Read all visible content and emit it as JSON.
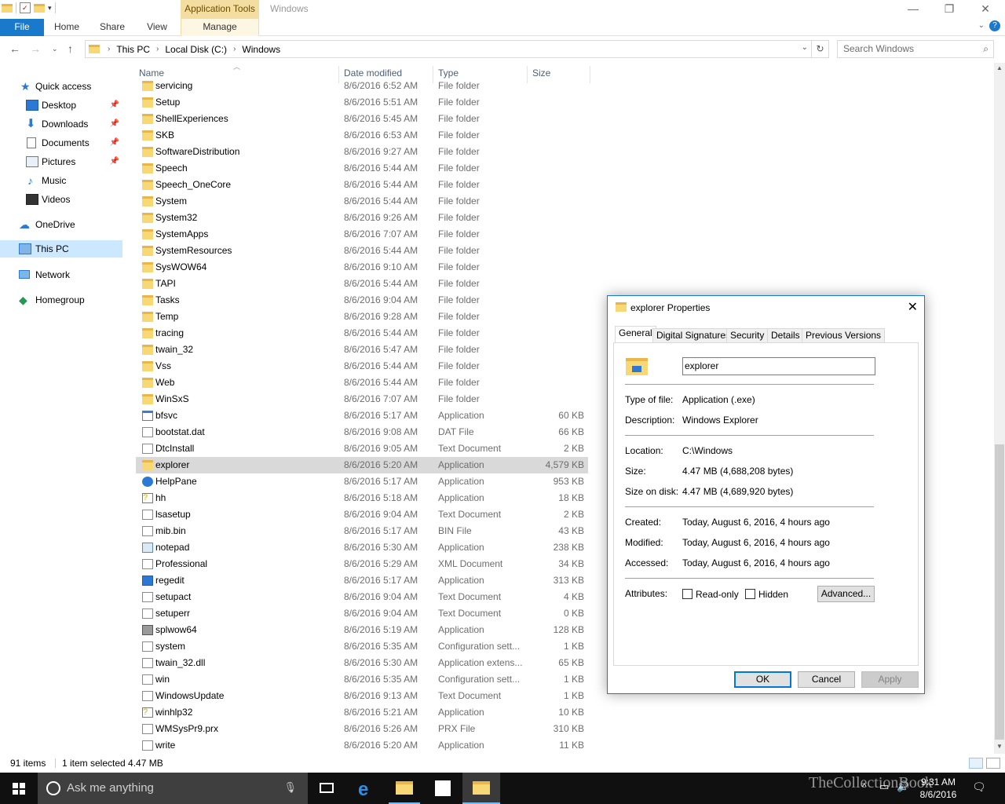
{
  "window": {
    "title": "Windows",
    "context_tab_title": "Application Tools",
    "controls": {
      "minimize": "—",
      "maximize": "❐",
      "close": "✕"
    }
  },
  "ribbon": {
    "tabs": [
      {
        "label": "File"
      },
      {
        "label": "Home"
      },
      {
        "label": "Share"
      },
      {
        "label": "View"
      },
      {
        "label": "Manage"
      }
    ]
  },
  "address": {
    "crumbs": [
      "This PC",
      "Local Disk (C:)",
      "Windows"
    ],
    "search_placeholder": "Search Windows"
  },
  "nav": {
    "items": [
      {
        "label": "Quick access",
        "icon": "star-icon",
        "pinned": false
      },
      {
        "label": "Desktop",
        "icon": "desktop-icon",
        "pinned": true
      },
      {
        "label": "Downloads",
        "icon": "download-icon",
        "pinned": true
      },
      {
        "label": "Documents",
        "icon": "documents-icon",
        "pinned": true
      },
      {
        "label": "Pictures",
        "icon": "pictures-icon",
        "pinned": true
      },
      {
        "label": "Music",
        "icon": "music-icon",
        "pinned": false
      },
      {
        "label": "Videos",
        "icon": "videos-icon",
        "pinned": false
      },
      {
        "label": "OneDrive",
        "icon": "cloud-icon",
        "pinned": false
      },
      {
        "label": "This PC",
        "icon": "computer-icon",
        "pinned": false,
        "selected": true
      },
      {
        "label": "Network",
        "icon": "network-icon",
        "pinned": false
      },
      {
        "label": "Homegroup",
        "icon": "homegroup-icon",
        "pinned": false
      }
    ]
  },
  "columns": {
    "name": "Name",
    "date": "Date modified",
    "type": "Type",
    "size": "Size"
  },
  "files": [
    {
      "name": "servicing",
      "date": "8/6/2016 6:52 AM",
      "type": "File folder",
      "size": "",
      "kind": "folder"
    },
    {
      "name": "Setup",
      "date": "8/6/2016 5:51 AM",
      "type": "File folder",
      "size": "",
      "kind": "folder"
    },
    {
      "name": "ShellExperiences",
      "date": "8/6/2016 5:45 AM",
      "type": "File folder",
      "size": "",
      "kind": "folder"
    },
    {
      "name": "SKB",
      "date": "8/6/2016 6:53 AM",
      "type": "File folder",
      "size": "",
      "kind": "folder"
    },
    {
      "name": "SoftwareDistribution",
      "date": "8/6/2016 9:27 AM",
      "type": "File folder",
      "size": "",
      "kind": "folder"
    },
    {
      "name": "Speech",
      "date": "8/6/2016 5:44 AM",
      "type": "File folder",
      "size": "",
      "kind": "folder"
    },
    {
      "name": "Speech_OneCore",
      "date": "8/6/2016 5:44 AM",
      "type": "File folder",
      "size": "",
      "kind": "folder"
    },
    {
      "name": "System",
      "date": "8/6/2016 5:44 AM",
      "type": "File folder",
      "size": "",
      "kind": "folder"
    },
    {
      "name": "System32",
      "date": "8/6/2016 9:26 AM",
      "type": "File folder",
      "size": "",
      "kind": "folder"
    },
    {
      "name": "SystemApps",
      "date": "8/6/2016 7:07 AM",
      "type": "File folder",
      "size": "",
      "kind": "folder"
    },
    {
      "name": "SystemResources",
      "date": "8/6/2016 5:44 AM",
      "type": "File folder",
      "size": "",
      "kind": "folder"
    },
    {
      "name": "SysWOW64",
      "date": "8/6/2016 9:10 AM",
      "type": "File folder",
      "size": "",
      "kind": "folder"
    },
    {
      "name": "TAPI",
      "date": "8/6/2016 5:44 AM",
      "type": "File folder",
      "size": "",
      "kind": "folder"
    },
    {
      "name": "Tasks",
      "date": "8/6/2016 9:04 AM",
      "type": "File folder",
      "size": "",
      "kind": "folder"
    },
    {
      "name": "Temp",
      "date": "8/6/2016 9:28 AM",
      "type": "File folder",
      "size": "",
      "kind": "folder"
    },
    {
      "name": "tracing",
      "date": "8/6/2016 5:44 AM",
      "type": "File folder",
      "size": "",
      "kind": "folder"
    },
    {
      "name": "twain_32",
      "date": "8/6/2016 5:47 AM",
      "type": "File folder",
      "size": "",
      "kind": "folder"
    },
    {
      "name": "Vss",
      "date": "8/6/2016 5:44 AM",
      "type": "File folder",
      "size": "",
      "kind": "folder"
    },
    {
      "name": "Web",
      "date": "8/6/2016 5:44 AM",
      "type": "File folder",
      "size": "",
      "kind": "folder"
    },
    {
      "name": "WinSxS",
      "date": "8/6/2016 7:07 AM",
      "type": "File folder",
      "size": "",
      "kind": "folder"
    },
    {
      "name": "bfsvc",
      "date": "8/6/2016 5:17 AM",
      "type": "Application",
      "size": "60 KB",
      "kind": "app"
    },
    {
      "name": "bootstat.dat",
      "date": "8/6/2016 9:08 AM",
      "type": "DAT File",
      "size": "66 KB",
      "kind": "doc"
    },
    {
      "name": "DtcInstall",
      "date": "8/6/2016 9:05 AM",
      "type": "Text Document",
      "size": "2 KB",
      "kind": "doc"
    },
    {
      "name": "explorer",
      "date": "8/6/2016 5:20 AM",
      "type": "Application",
      "size": "4,579 KB",
      "kind": "explorer",
      "selected": true
    },
    {
      "name": "HelpPane",
      "date": "8/6/2016 5:17 AM",
      "type": "Application",
      "size": "953 KB",
      "kind": "help"
    },
    {
      "name": "hh",
      "date": "8/6/2016 5:18 AM",
      "type": "Application",
      "size": "18 KB",
      "kind": "hh"
    },
    {
      "name": "lsasetup",
      "date": "8/6/2016 9:04 AM",
      "type": "Text Document",
      "size": "2 KB",
      "kind": "doc"
    },
    {
      "name": "mib.bin",
      "date": "8/6/2016 5:17 AM",
      "type": "BIN File",
      "size": "43 KB",
      "kind": "doc"
    },
    {
      "name": "notepad",
      "date": "8/6/2016 5:30 AM",
      "type": "Application",
      "size": "238 KB",
      "kind": "notepad"
    },
    {
      "name": "Professional",
      "date": "8/6/2016 5:29 AM",
      "type": "XML Document",
      "size": "34 KB",
      "kind": "xml"
    },
    {
      "name": "regedit",
      "date": "8/6/2016 5:17 AM",
      "type": "Application",
      "size": "313 KB",
      "kind": "regedit"
    },
    {
      "name": "setupact",
      "date": "8/6/2016 9:04 AM",
      "type": "Text Document",
      "size": "4 KB",
      "kind": "doc"
    },
    {
      "name": "setuperr",
      "date": "8/6/2016 9:04 AM",
      "type": "Text Document",
      "size": "0 KB",
      "kind": "doc"
    },
    {
      "name": "splwow64",
      "date": "8/6/2016 5:19 AM",
      "type": "Application",
      "size": "128 KB",
      "kind": "printer"
    },
    {
      "name": "system",
      "date": "8/6/2016 5:35 AM",
      "type": "Configuration sett...",
      "size": "1 KB",
      "kind": "config"
    },
    {
      "name": "twain_32.dll",
      "date": "8/6/2016 5:30 AM",
      "type": "Application extens...",
      "size": "65 KB",
      "kind": "dll"
    },
    {
      "name": "win",
      "date": "8/6/2016 5:35 AM",
      "type": "Configuration sett...",
      "size": "1 KB",
      "kind": "config"
    },
    {
      "name": "WindowsUpdate",
      "date": "8/6/2016 9:13 AM",
      "type": "Text Document",
      "size": "1 KB",
      "kind": "doc"
    },
    {
      "name": "winhlp32",
      "date": "8/6/2016 5:21 AM",
      "type": "Application",
      "size": "10 KB",
      "kind": "hh"
    },
    {
      "name": "WMSysPr9.prx",
      "date": "8/6/2016 5:26 AM",
      "type": "PRX File",
      "size": "310 KB",
      "kind": "doc"
    },
    {
      "name": "write",
      "date": "8/6/2016 5:20 AM",
      "type": "Application",
      "size": "11 KB",
      "kind": "write"
    }
  ],
  "status": {
    "count": "91 items",
    "selection": "1 item selected  4.47 MB"
  },
  "dialog": {
    "title": "explorer Properties",
    "tabs": [
      "General",
      "Digital Signatures",
      "Security",
      "Details",
      "Previous Versions"
    ],
    "name_value": "explorer",
    "fields": {
      "type_label": "Type of file:",
      "type_value": "Application (.exe)",
      "desc_label": "Description:",
      "desc_value": "Windows Explorer",
      "loc_label": "Location:",
      "loc_value": "C:\\Windows",
      "size_label": "Size:",
      "size_value": "4.47 MB (4,688,208 bytes)",
      "sod_label": "Size on disk:",
      "sod_value": "4.47 MB (4,689,920 bytes)",
      "created_label": "Created:",
      "created_value": "Today, August 6, 2016, 4 hours ago",
      "modified_label": "Modified:",
      "modified_value": "Today, August 6, 2016, 4 hours ago",
      "accessed_label": "Accessed:",
      "accessed_value": "Today, August 6, 2016, 4 hours ago",
      "attr_label": "Attributes:",
      "readonly_label": "Read-only",
      "hidden_label": "Hidden",
      "advanced_label": "Advanced..."
    },
    "buttons": {
      "ok": "OK",
      "cancel": "Cancel",
      "apply": "Apply"
    }
  },
  "taskbar": {
    "search_text": "Ask me anything",
    "time": "9:31 AM",
    "date": "8/6/2016"
  },
  "watermark": "TheCollectionBook",
  "colors": {
    "accent": "#1979ca",
    "context_tab": "#f4dda1",
    "selection": "#d9d9d9",
    "nav_selection": "#cce8ff"
  }
}
